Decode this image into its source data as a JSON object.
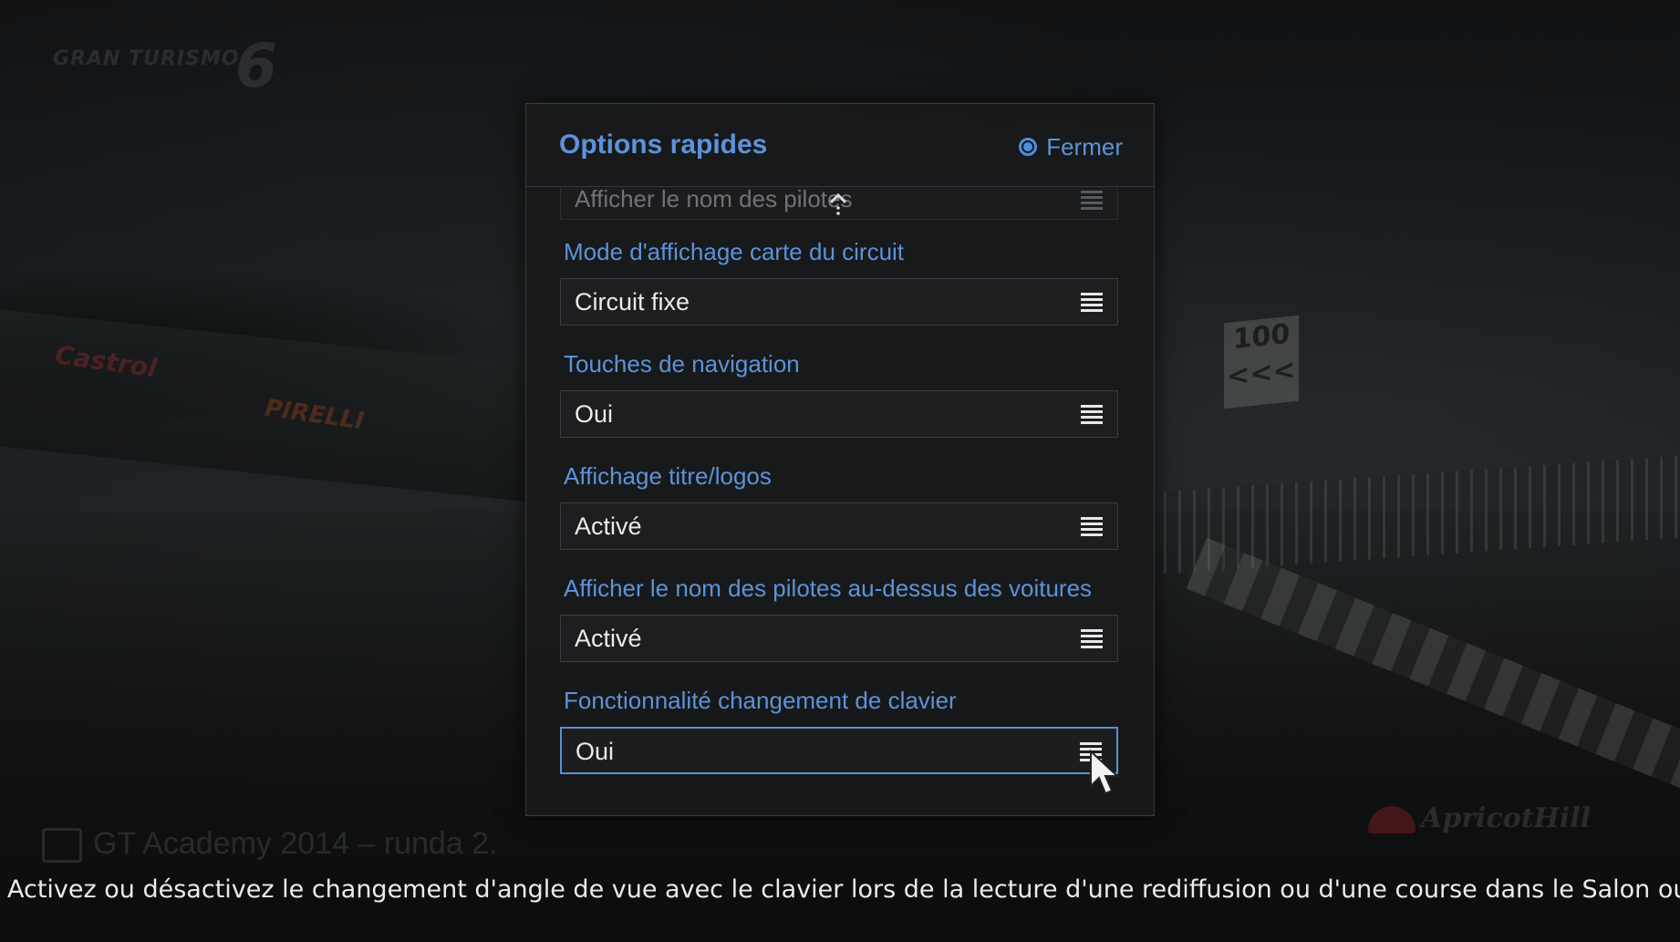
{
  "background": {
    "game_logo": "GRAN TURISMO",
    "game_logo_number": "6",
    "banner_left": "Castrol",
    "banner_mid": "PIRELLI",
    "distance_sign": "100",
    "distance_sign_arrows": "<<<",
    "venue_logo": "ApricotHill",
    "event_title": "GT Academy 2014 – runda 2."
  },
  "dialog": {
    "title": "Options rapides",
    "close_label": "Fermer",
    "partial_row_value": "Afficher le nom des pilotes",
    "fields": [
      {
        "label": "Mode d'affichage carte du circuit",
        "value": "Circuit fixe"
      },
      {
        "label": "Touches de navigation",
        "value": "Oui"
      },
      {
        "label": "Affichage titre/logos",
        "value": "Activé"
      },
      {
        "label": "Afficher le nom des pilotes au-dessus des voitures",
        "value": "Activé"
      },
      {
        "label": "Fonctionnalité changement de clavier",
        "value": "Oui"
      }
    ]
  },
  "hint": "Activez ou désactivez le changement d'angle de vue avec le clavier lors de la lecture d'une rediffusion ou d'une course dans le Salon ou",
  "icons": {
    "close": "circle-button-icon",
    "select": "menu-lines-icon",
    "scroll": "scroll-up-arrow-icon",
    "pointer": "mouse-pointer-icon"
  },
  "colors": {
    "accent": "#5b93db",
    "panel": "#18191a",
    "field_bg": "#1d1e1f",
    "text": "#e8eaec"
  }
}
